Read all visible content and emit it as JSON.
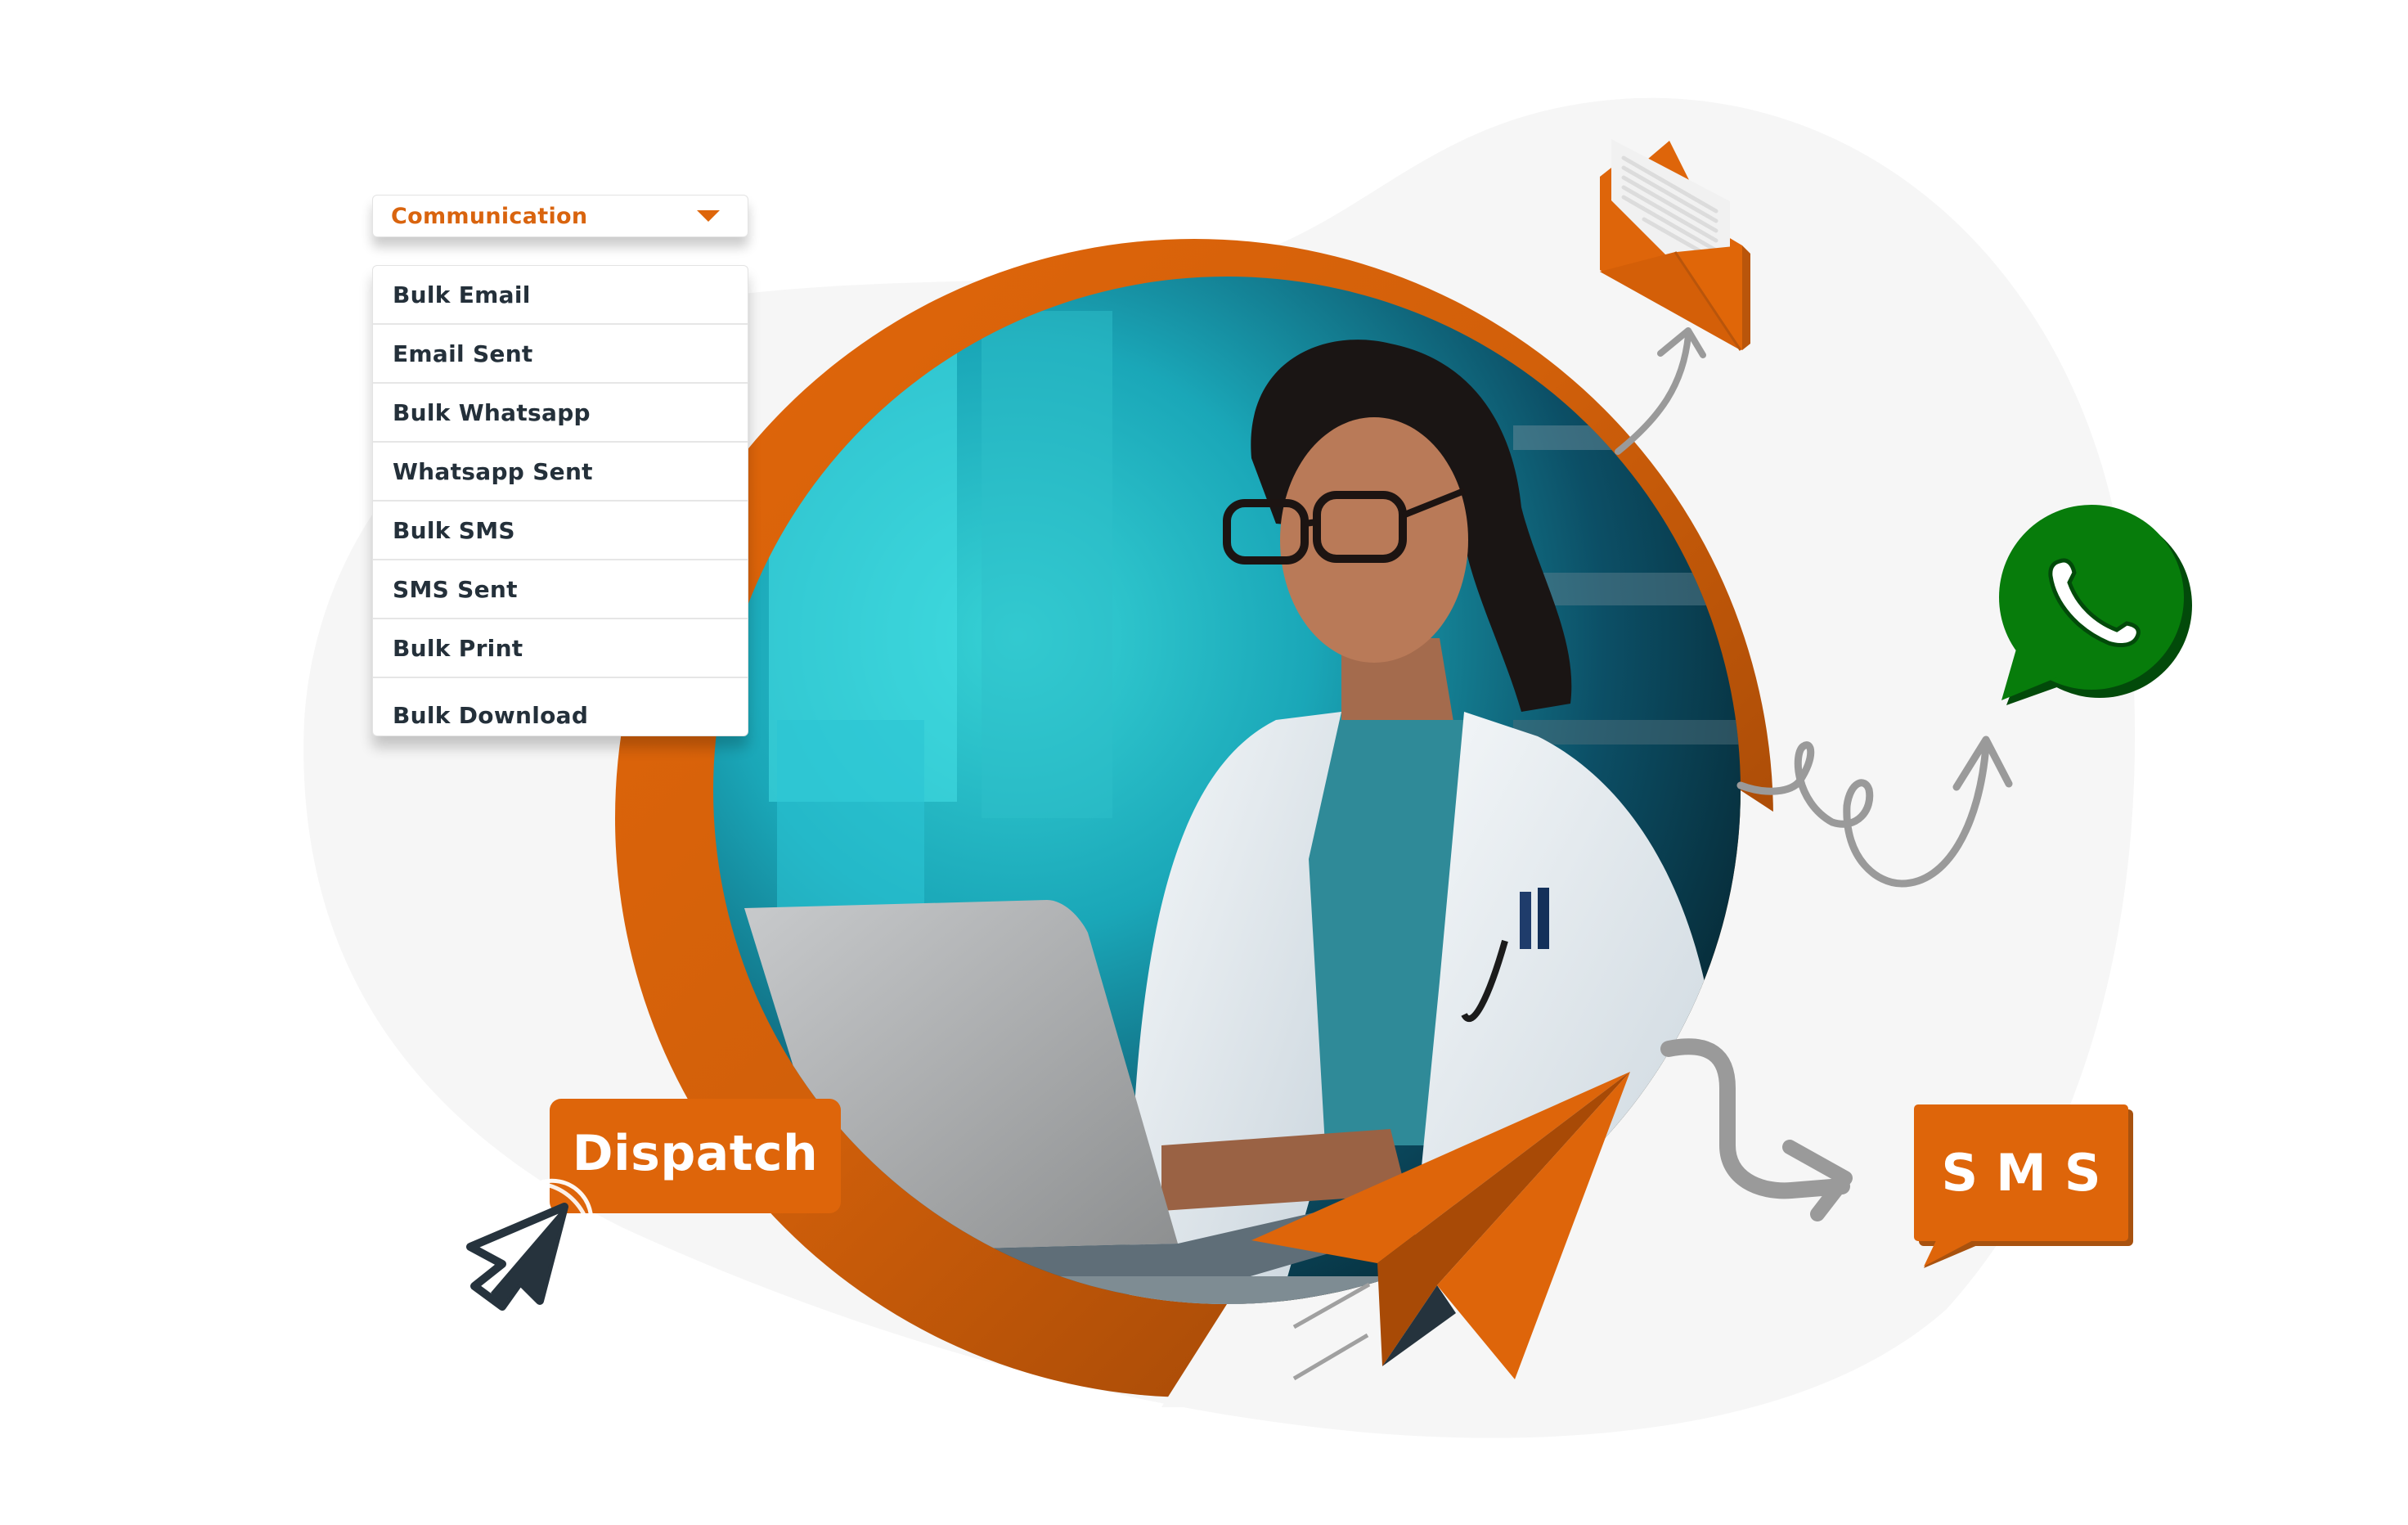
{
  "dropdown": {
    "label": "Communication",
    "caret_icon": "caret-down-icon",
    "items": [
      {
        "label": "Bulk Email"
      },
      {
        "label": "Email Sent"
      },
      {
        "label": "Bulk Whatsapp"
      },
      {
        "label": "Whatsapp Sent"
      },
      {
        "label": "Bulk SMS"
      },
      {
        "label": "SMS Sent"
      },
      {
        "label": "Bulk Print"
      },
      {
        "label": "Bulk Download"
      }
    ]
  },
  "dispatch_button": {
    "label": "Dispatch",
    "cursor_icon": "mouse-pointer-click-icon"
  },
  "channels": {
    "email_icon": "open-envelope-icon",
    "whatsapp_icon": "whatsapp-icon",
    "sms_label": "SMS",
    "paper_plane_icon": "paper-plane-icon"
  },
  "hero": {
    "photo_subject": "clinician-with-laptop"
  },
  "colors": {
    "brand_orange": "#DE650A",
    "brand_orange_dark": "#A84A06",
    "whatsapp_green": "#077C0B",
    "whatsapp_shadow": "#024A0A",
    "text_dark": "#24303A",
    "arrow_gray": "#9A9A9A",
    "blob_gray": "#F6F6F6"
  }
}
